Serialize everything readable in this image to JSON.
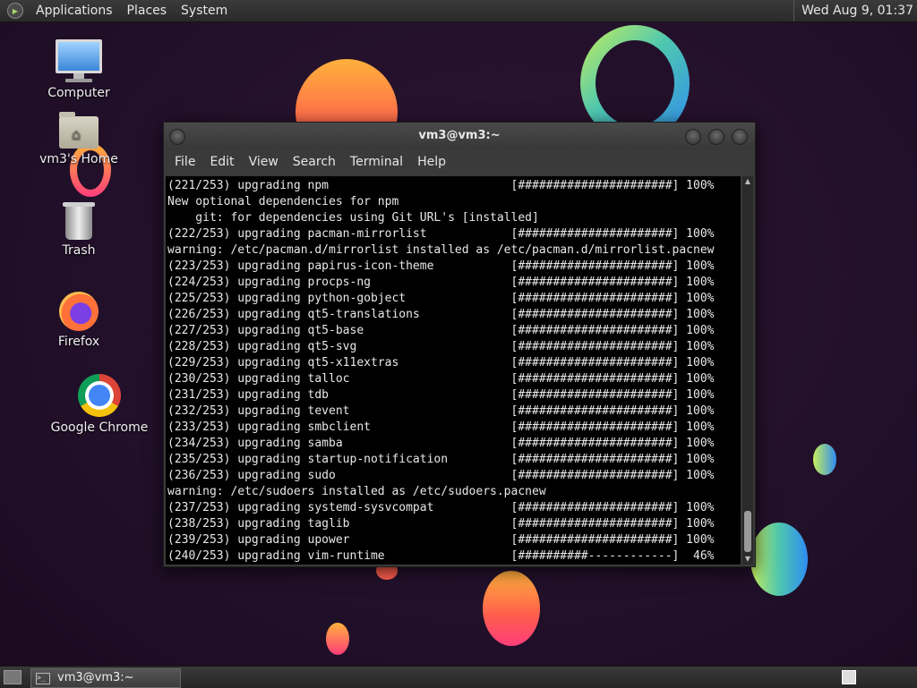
{
  "top_panel": {
    "menus": [
      "Applications",
      "Places",
      "System"
    ],
    "clock": "Wed Aug  9, 01:37"
  },
  "desktop_icons": {
    "computer": "Computer",
    "home": "vm3's Home",
    "trash": "Trash",
    "firefox": "Firefox",
    "chrome": "Google Chrome"
  },
  "window": {
    "title": "vm3@vm3:~",
    "menus": [
      "File",
      "Edit",
      "View",
      "Search",
      "Terminal",
      "Help"
    ],
    "lines": [
      "(221/253) upgrading npm                          [######################] 100%",
      "New optional dependencies for npm",
      "    git: for dependencies using Git URL's [installed]",
      "(222/253) upgrading pacman-mirrorlist            [######################] 100%",
      "warning: /etc/pacman.d/mirrorlist installed as /etc/pacman.d/mirrorlist.pacnew",
      "(223/253) upgrading papirus-icon-theme           [######################] 100%",
      "(224/253) upgrading procps-ng                    [######################] 100%",
      "(225/253) upgrading python-gobject               [######################] 100%",
      "(226/253) upgrading qt5-translations             [######################] 100%",
      "(227/253) upgrading qt5-base                     [######################] 100%",
      "(228/253) upgrading qt5-svg                      [######################] 100%",
      "(229/253) upgrading qt5-x11extras                [######################] 100%",
      "(230/253) upgrading talloc                       [######################] 100%",
      "(231/253) upgrading tdb                          [######################] 100%",
      "(232/253) upgrading tevent                       [######################] 100%",
      "(233/253) upgrading smbclient                    [######################] 100%",
      "(234/253) upgrading samba                        [######################] 100%",
      "(235/253) upgrading startup-notification         [######################] 100%",
      "(236/253) upgrading sudo                         [######################] 100%",
      "warning: /etc/sudoers installed as /etc/sudoers.pacnew",
      "(237/253) upgrading systemd-sysvcompat           [######################] 100%",
      "(238/253) upgrading taglib                       [######################] 100%",
      "(239/253) upgrading upower                       [######################] 100%",
      "(240/253) upgrading vim-runtime                  [##########------------]  46%"
    ]
  },
  "taskbar": {
    "task_label": "vm3@vm3:~",
    "task_icon_glyph": ">_"
  }
}
